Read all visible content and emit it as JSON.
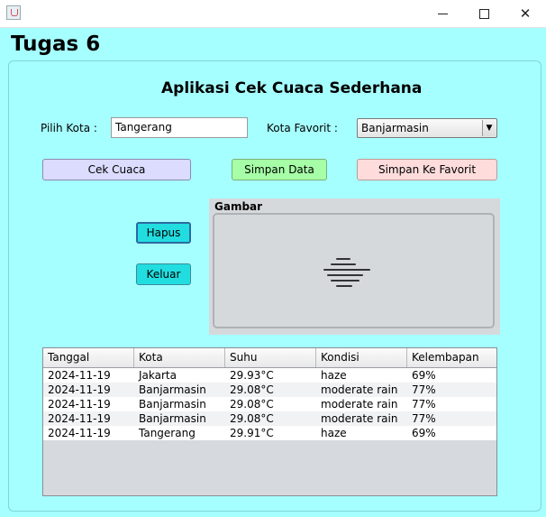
{
  "window": {
    "icon": "java-icon",
    "controls": [
      "minimize-icon",
      "maximize-icon",
      "close-icon"
    ],
    "close_glyph": "✕"
  },
  "app_title": "Tugas 6",
  "main": {
    "heading": "Aplikasi Cek Cuaca Sederhana",
    "city_label": "Pilih Kota :",
    "city_value": "Tangerang",
    "favorite_label": "Kota Favorit :",
    "favorite_selected": "Banjarmasin",
    "combo_arrow": "▼",
    "buttons": {
      "check": "Cek Cuaca",
      "save": "Simpan Data",
      "save_favorite": "Simpan Ke Favorit",
      "delete": "Hapus",
      "exit": "Keluar"
    },
    "image_panel": {
      "title": "Gambar",
      "icon": "fog-icon"
    }
  },
  "table": {
    "columns": [
      "Tanggal",
      "Kota",
      "Suhu",
      "Kondisi",
      "Kelembapan"
    ],
    "rows": [
      [
        "2024-11-19",
        "Jakarta",
        "29.93°C",
        "haze",
        "69%"
      ],
      [
        "2024-11-19",
        "Banjarmasin",
        "29.08°C",
        "moderate rain",
        "77%"
      ],
      [
        "2024-11-19",
        "Banjarmasin",
        "29.08°C",
        "moderate rain",
        "77%"
      ],
      [
        "2024-11-19",
        "Banjarmasin",
        "29.08°C",
        "moderate rain",
        "77%"
      ],
      [
        "2024-11-19",
        "Tangerang",
        "29.91°C",
        "haze",
        "69%"
      ]
    ]
  },
  "colors": {
    "background": "#a6ffff",
    "check_button": "#dcdcff",
    "save_button": "#a6ffa6",
    "favorite_button": "#ffdcdc",
    "action_button": "#22dde0"
  }
}
